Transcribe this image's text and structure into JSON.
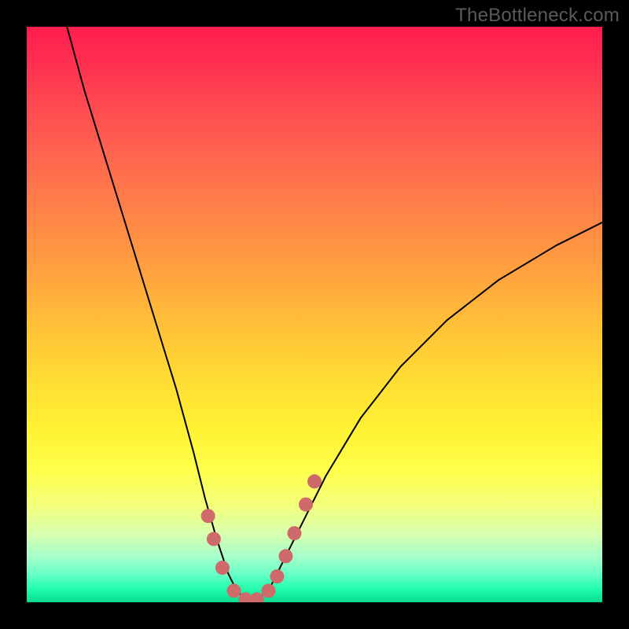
{
  "watermark": "TheBottleneck.com",
  "chart_data": {
    "type": "line",
    "title": "",
    "xlabel": "",
    "ylabel": "",
    "xlim": [
      0,
      100
    ],
    "ylim": [
      0,
      100
    ],
    "series": [
      {
        "name": "bottleneck-curve",
        "x": [
          7,
          10,
          14,
          18,
          22,
          26,
          29,
          31,
          33,
          35,
          36.5,
          38,
          40,
          42,
          44,
          47,
          52,
          58,
          65,
          73,
          82,
          92,
          100
        ],
        "y": [
          100,
          89,
          76,
          63,
          50,
          37,
          26,
          18,
          11,
          5,
          2,
          0.5,
          0.5,
          2,
          6,
          12,
          22,
          32,
          41,
          49,
          56,
          62,
          66
        ]
      }
    ],
    "marker_points": {
      "name": "highlight-dots",
      "color": "#cf6a6a",
      "x": [
        31.5,
        32.5,
        34,
        36,
        38,
        40,
        42,
        43.5,
        45,
        46.5,
        48.5,
        50
      ],
      "y": [
        15,
        11,
        6,
        2,
        0.5,
        0.5,
        2,
        4.5,
        8,
        12,
        17,
        21
      ]
    }
  }
}
